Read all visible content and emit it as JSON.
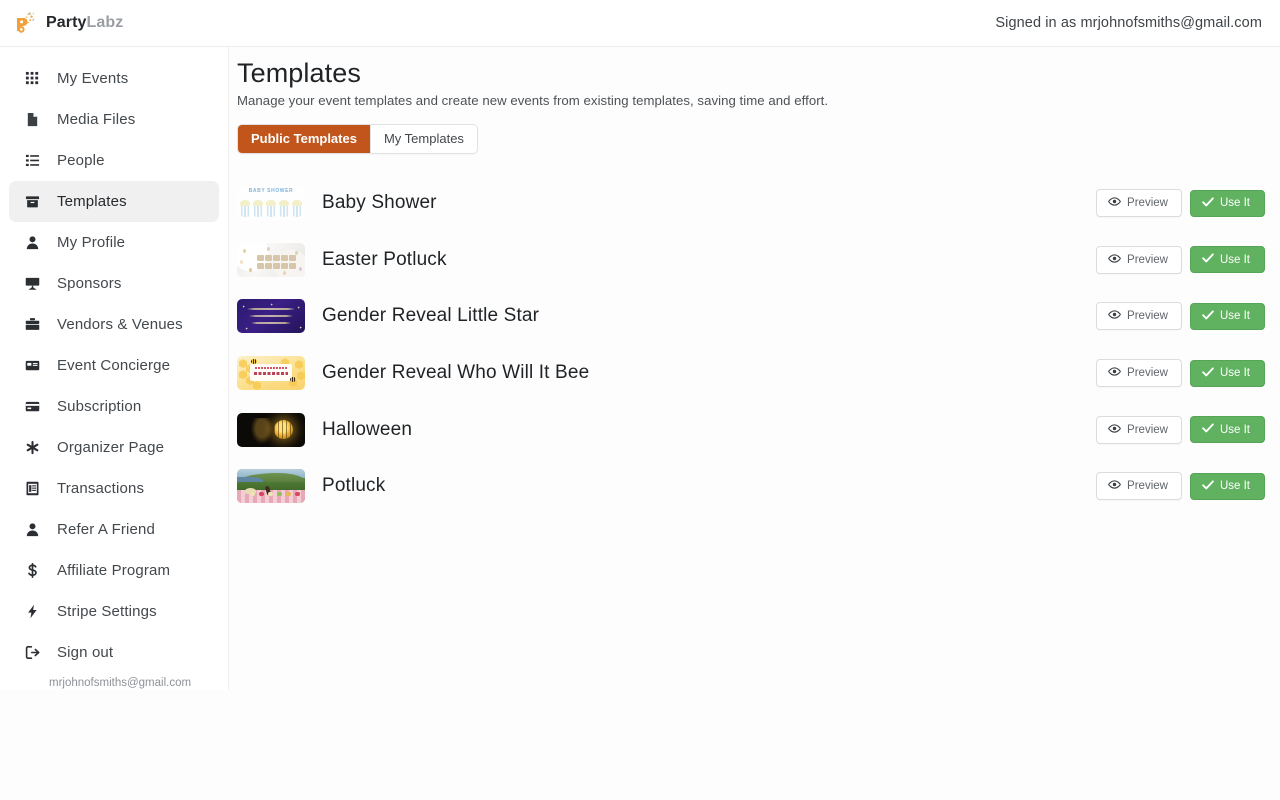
{
  "header": {
    "brand_primary": "Party",
    "brand_secondary": "Labz",
    "signed_in_text": "Signed in as mrjohnofsmiths@gmail.com"
  },
  "sidebar": {
    "items": [
      {
        "label": "My Events",
        "icon": "grid-icon",
        "active": false
      },
      {
        "label": "Media Files",
        "icon": "file-icon",
        "active": false
      },
      {
        "label": "People",
        "icon": "list-icon",
        "active": false
      },
      {
        "label": "Templates",
        "icon": "archive-icon",
        "active": true
      },
      {
        "label": "My Profile",
        "icon": "user-icon",
        "active": false
      },
      {
        "label": "Sponsors",
        "icon": "presentation-icon",
        "active": false
      },
      {
        "label": "Vendors & Venues",
        "icon": "briefcase-icon",
        "active": false
      },
      {
        "label": "Event Concierge",
        "icon": "card-icon",
        "active": false
      },
      {
        "label": "Subscription",
        "icon": "credit-card-icon",
        "active": false
      },
      {
        "label": "Organizer Page",
        "icon": "asterisk-icon",
        "active": false
      },
      {
        "label": "Transactions",
        "icon": "receipt-icon",
        "active": false
      },
      {
        "label": "Refer A Friend",
        "icon": "user-icon",
        "active": false
      },
      {
        "label": "Affiliate Program",
        "icon": "dollar-icon",
        "active": false
      },
      {
        "label": "Stripe Settings",
        "icon": "bolt-icon",
        "active": false
      },
      {
        "label": "Sign out",
        "icon": "sign-out-icon",
        "active": false
      }
    ],
    "account_email": "mrjohnofsmiths@gmail.com"
  },
  "main": {
    "title": "Templates",
    "subtitle": "Manage your event templates and create new events from existing templates, saving time and effort.",
    "tabs": [
      {
        "label": "Public Templates",
        "active": true
      },
      {
        "label": "My Templates",
        "active": false
      }
    ],
    "preview_label": "Preview",
    "use_label": "Use It",
    "templates": [
      {
        "name": "Baby Shower",
        "thumb": "baby-shower"
      },
      {
        "name": "Easter Potluck",
        "thumb": "easter-potluck"
      },
      {
        "name": "Gender Reveal Little Star",
        "thumb": "gender-reveal-little-star"
      },
      {
        "name": "Gender Reveal Who Will It Bee",
        "thumb": "gender-reveal-bee"
      },
      {
        "name": "Halloween",
        "thumb": "halloween"
      },
      {
        "name": "Potluck",
        "thumb": "potluck"
      }
    ]
  },
  "colors": {
    "accent_orange": "#c2551c",
    "use_it_green": "#60b260",
    "sidebar_active": "#f0f0f0",
    "logo_orange": "#f0a13c"
  }
}
